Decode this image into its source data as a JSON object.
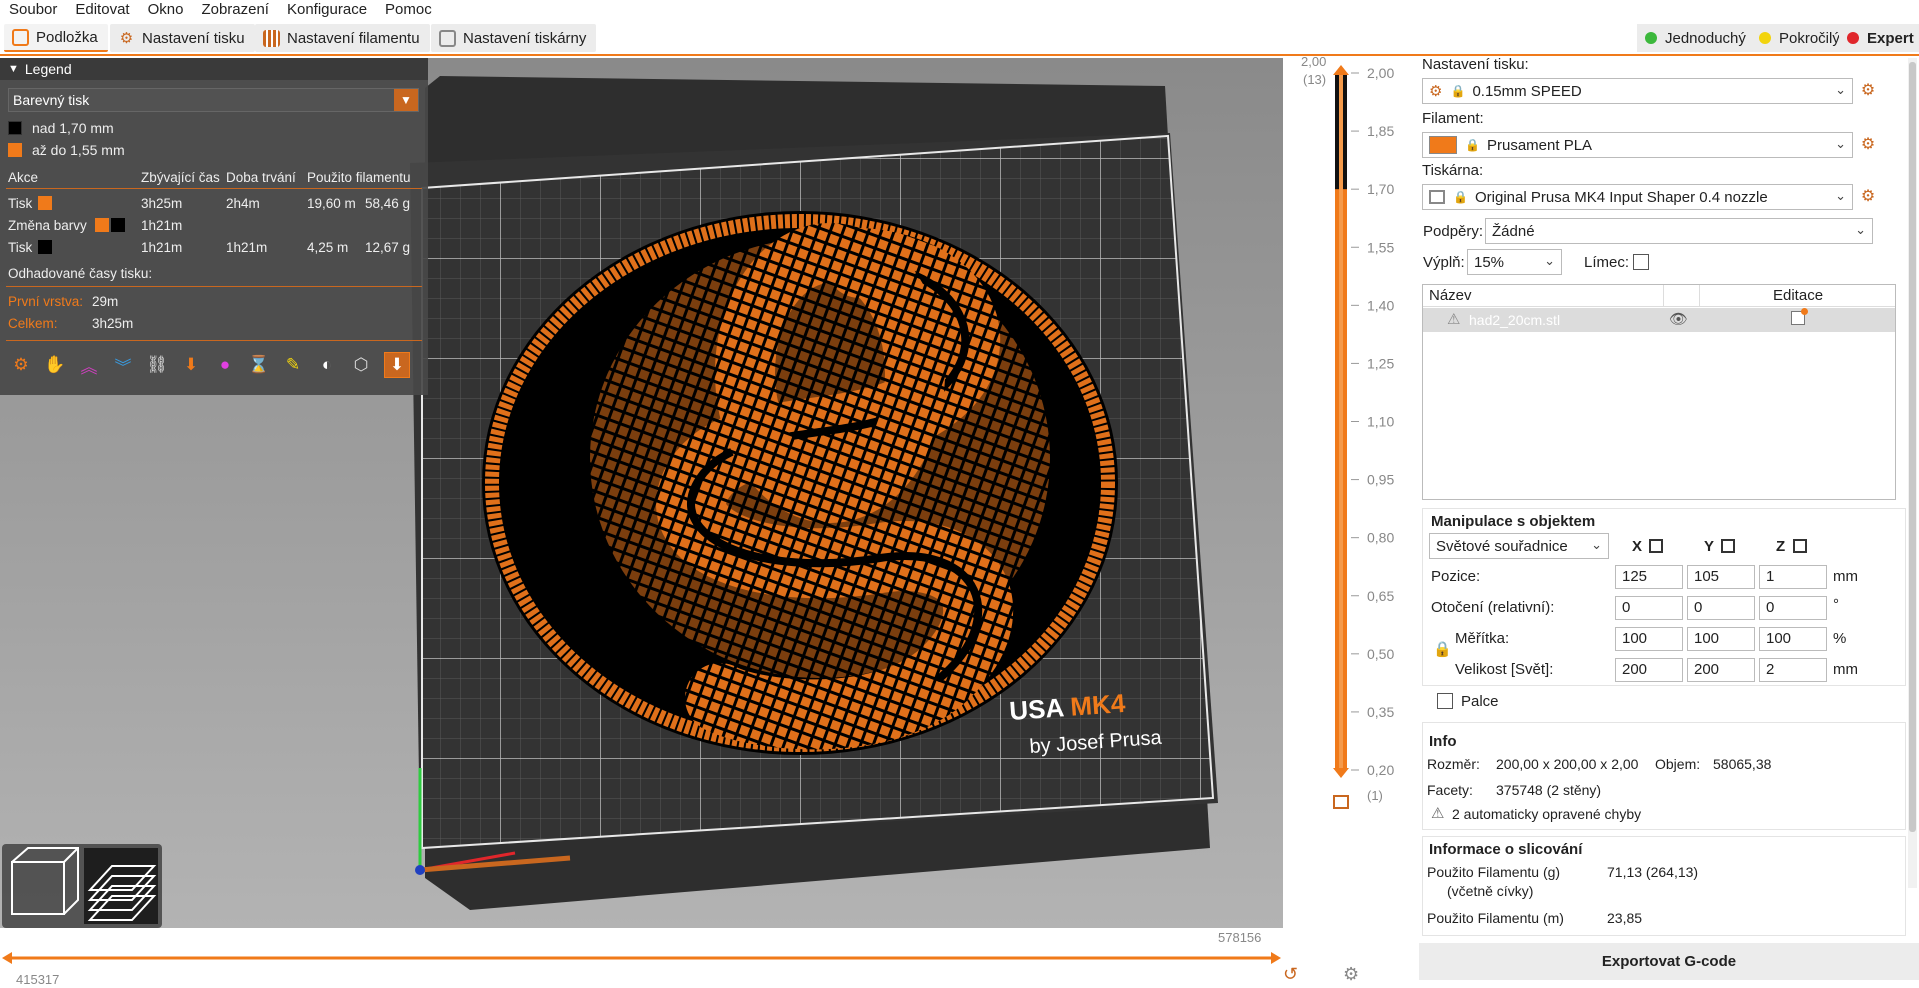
{
  "menu": [
    "Soubor",
    "Editovat",
    "Okno",
    "Zobrazení",
    "Konfigurace",
    "Pomoc"
  ],
  "tabs": [
    {
      "label": "Podložka",
      "icon": "plater-icon",
      "active": true
    },
    {
      "label": "Nastavení tisku",
      "icon": "gear-icon",
      "active": false
    },
    {
      "label": "Nastavení filamentu",
      "icon": "spool-icon",
      "active": false
    },
    {
      "label": "Nastavení tiskárny",
      "icon": "printer-icon",
      "active": false
    }
  ],
  "modes": [
    {
      "label": "Jednoduchý",
      "color": "#3cb83c"
    },
    {
      "label": "Pokročilý",
      "color": "#f2d40e"
    },
    {
      "label": "Expert",
      "color": "#e0262b"
    }
  ],
  "legend": {
    "title": "Legend",
    "view_type": "Barevný tisk",
    "ranges": [
      {
        "label": "nad 1,70 mm",
        "color": "#000000"
      },
      {
        "label": "až do 1,55 mm",
        "color": "#f07a1a"
      }
    ],
    "columns": [
      "Akce",
      "Zbývající čas",
      "Doba trvání",
      "Použito filamentu"
    ],
    "rows": [
      {
        "action": "Tisk",
        "remaining": "3h25m",
        "duration": "2h4m",
        "length": "19,60 m",
        "weight": "58,46 g"
      },
      {
        "action": "Změna barvy",
        "remaining": "1h21m",
        "duration": "",
        "length": "",
        "weight": ""
      },
      {
        "action": "Tisk",
        "remaining": "1h21m",
        "duration": "1h21m",
        "length": "4,25 m",
        "weight": "12,67 g"
      }
    ],
    "estimated_label": "Odhadované časy tisku:",
    "first_layer_label": "První vrstva:",
    "first_layer_value": "29m",
    "total_label": "Celkem:",
    "total_value": "3h25m",
    "tools": [
      "travel-icon",
      "wipe-icon",
      "retractions-icon",
      "deretractions-icon",
      "seams-icon",
      "tool-changes-icon",
      "color-changes-icon",
      "pause-icon",
      "custom-gcode-icon",
      "center-of-gravity-icon",
      "shells-icon",
      "tool-marker-icon"
    ]
  },
  "bed": {
    "brand": "USA",
    "brand_model": "MK4",
    "brand_sub": "by Josef Prusa"
  },
  "hslider": {
    "left_value": "415317",
    "right_value": "578156"
  },
  "vslider": {
    "top_value": "2,00",
    "top_layer": "(13)",
    "bottom_value": "0,20",
    "bottom_layer": "(1)",
    "ticks": [
      "2,00",
      "1,85",
      "1,70",
      "1,55",
      "1,40",
      "1,25",
      "1,10",
      "0,95",
      "0,80",
      "0,65",
      "0,50",
      "0,35",
      "0,20"
    ],
    "color_change_at": 1.7
  },
  "right": {
    "print_settings_label": "Nastavení tisku:",
    "print_profile": "0.15mm SPEED",
    "filament_label": "Filament:",
    "filament_profile": "Prusament PLA",
    "filament_color": "#f07a1a",
    "printer_label": "Tiskárna:",
    "printer_profile": "Original Prusa MK4 Input Shaper 0.4 nozzle",
    "supports_label": "Podpěry:",
    "supports_value": "Žádné",
    "infill_label": "Výplň:",
    "infill_value": "15%",
    "brim_label": "Límec:",
    "objects_col_name": "Název",
    "objects_col_edit": "Editace",
    "object_name": "had2_20cm.stl"
  },
  "manipulation": {
    "title": "Manipulace s objektem",
    "coords": "Světové souřadnice",
    "axes": [
      "X",
      "Y",
      "Z"
    ],
    "position_label": "Pozice:",
    "position": [
      "125",
      "105",
      "1"
    ],
    "position_unit": "mm",
    "rotation_label": "Otočení (relativní):",
    "rotation": [
      "0",
      "0",
      "0"
    ],
    "rotation_unit": "°",
    "scale_label": "Měřítka:",
    "scale": [
      "100",
      "100",
      "100"
    ],
    "scale_unit": "%",
    "size_label": "Velikost [Svět]:",
    "size": [
      "200",
      "200",
      "2"
    ],
    "size_unit": "mm",
    "inches_label": "Palce"
  },
  "info": {
    "title": "Info",
    "size_label": "Rozměr:",
    "size_value": "200,00 x 200,00 x 2,00",
    "volume_label": "Objem:",
    "volume_value": "58065,38",
    "facets_label": "Facety:",
    "facets_value": "375748 (2 stěny)",
    "errors": "2 automaticky opravené chyby"
  },
  "slice_info": {
    "title": "Informace o slicování",
    "filament_g_label": "Použito Filamentu (g)",
    "filament_g_sub": "(včetně cívky)",
    "filament_g_value": "71,13 (264,13)",
    "filament_m_label": "Použito Filamentu (m)",
    "filament_m_value": "23,85"
  },
  "export_label": "Exportovat G-code"
}
